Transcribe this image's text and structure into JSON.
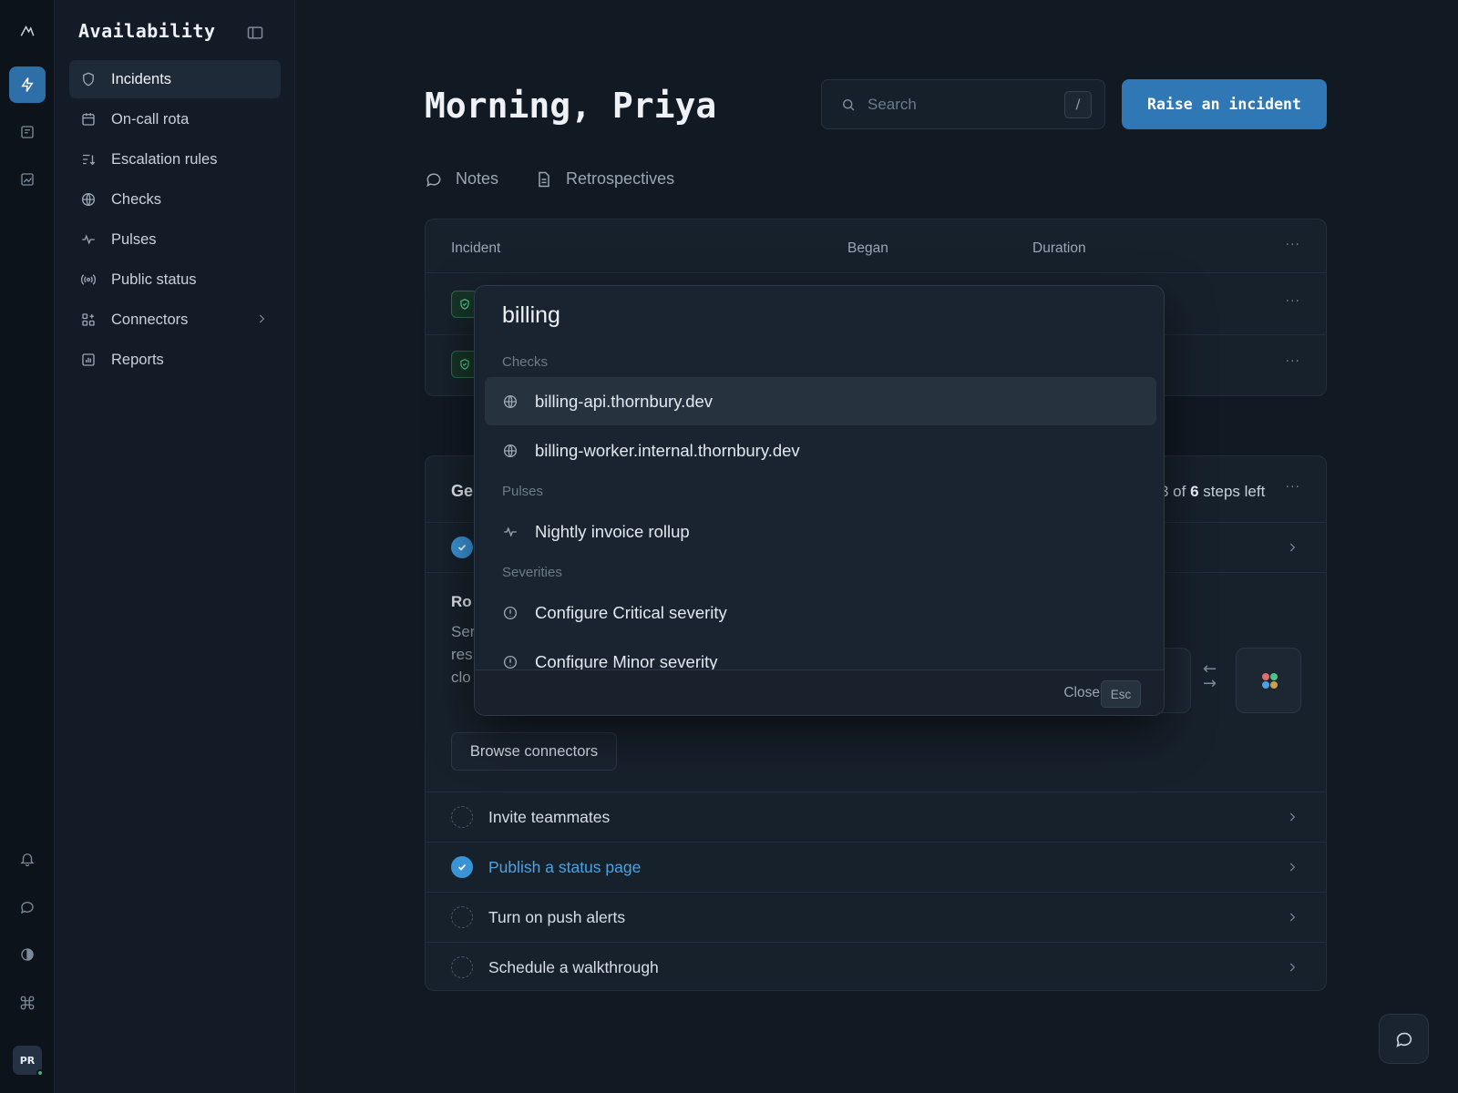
{
  "app": {
    "title": "Availability",
    "user_initials": "PR"
  },
  "rail": {
    "top_icons": [
      "logo-icon",
      "bolt-icon",
      "document-icon",
      "chart-icon"
    ],
    "bottom_icons": [
      "bell-icon",
      "chat-icon",
      "contrast-icon",
      "command-icon"
    ]
  },
  "sidebar": {
    "items": [
      {
        "label": "Incidents",
        "icon": "shield-icon",
        "active": true
      },
      {
        "label": "On-call rota",
        "icon": "calendar-icon"
      },
      {
        "label": "Escalation rules",
        "icon": "sort-icon"
      },
      {
        "label": "Checks",
        "icon": "globe-icon"
      },
      {
        "label": "Pulses",
        "icon": "pulse-icon"
      },
      {
        "label": "Public status",
        "icon": "broadcast-icon"
      },
      {
        "label": "Connectors",
        "icon": "connectors-icon",
        "has_submenu": true
      },
      {
        "label": "Reports",
        "icon": "report-icon"
      }
    ]
  },
  "header": {
    "greeting": "Morning, Priya",
    "search_placeholder": "Search",
    "search_shortcut": "/",
    "raise_button": "Raise an incident"
  },
  "tabs": [
    {
      "label": "Notes",
      "icon": "speech-bubble-icon"
    },
    {
      "label": "Retrospectives",
      "icon": "file-icon"
    }
  ],
  "incidents_table": {
    "columns": [
      "Incident",
      "Began",
      "Duration"
    ],
    "more": "···"
  },
  "setup": {
    "title_partial": "Ge",
    "steps_prefix": "3 of ",
    "steps_total": "6",
    "steps_suffix": " steps left",
    "section_partial": "Ro",
    "desc_partial": [
      "Ser",
      "res",
      "clo"
    ],
    "browse_button": "Browse connectors",
    "steps": [
      {
        "label": "Invite teammates",
        "done": false
      },
      {
        "label": "Publish a status page",
        "done": true
      },
      {
        "label": "Turn on push alerts",
        "done": false
      },
      {
        "label": "Schedule a walkthrough",
        "done": false
      }
    ]
  },
  "palette": {
    "query": "billing",
    "groups": [
      {
        "title": "Checks",
        "items": [
          {
            "label": "billing-api.thornbury.dev",
            "icon": "globe-icon",
            "selected": true
          },
          {
            "label": "billing-worker.internal.thornbury.dev",
            "icon": "globe-icon"
          }
        ]
      },
      {
        "title": "Pulses",
        "items": [
          {
            "label": "Nightly invoice rollup",
            "icon": "pulse-icon"
          }
        ]
      },
      {
        "title": "Severities",
        "items": [
          {
            "label": "Configure Critical severity",
            "icon": "alert-circle-icon"
          },
          {
            "label": "Configure Minor severity",
            "icon": "alert-circle-icon"
          }
        ]
      }
    ],
    "close_label": "Close",
    "close_key": "Esc"
  },
  "colors": {
    "accent": "#2f78b5",
    "link": "#4ba3e3",
    "success": "#4cc38a",
    "background": "#111923"
  }
}
